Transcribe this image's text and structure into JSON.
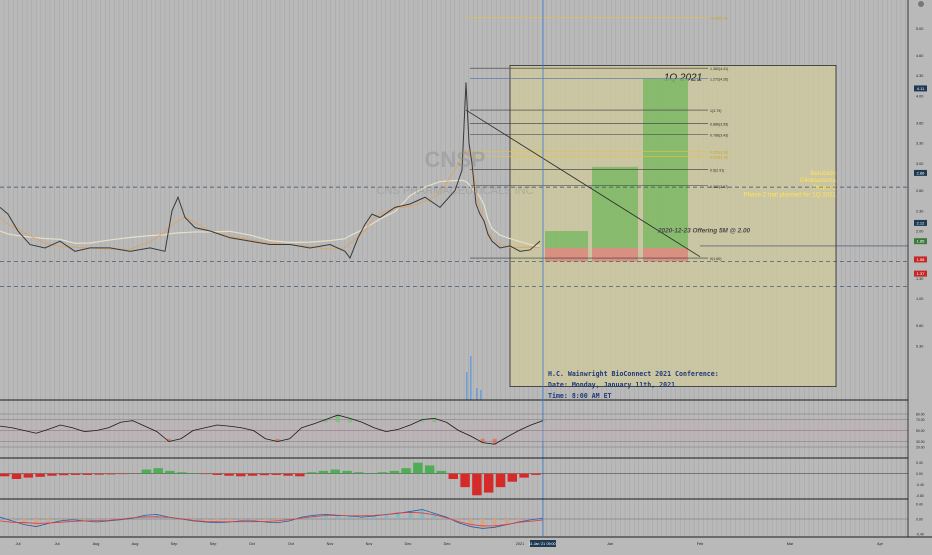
{
  "chart_data": {
    "type": "line",
    "title": "",
    "symbol": "CNSP",
    "company": "CNS PHARMACEUTICALS INC",
    "x_ticks": [
      "Jul",
      "Jul",
      "Aug",
      "Aug",
      "Sep",
      "Sep",
      "Oct",
      "Oct",
      "Nov",
      "Nov",
      "Dec",
      "Dec",
      "2021",
      "Jan",
      "Feb",
      "Mar",
      "Apr"
    ],
    "price_axis": [
      {
        "label": "5.00",
        "value": 5.0
      },
      {
        "label": "4.60",
        "value": 4.6
      },
      {
        "label": "4.30",
        "value": 4.3
      },
      {
        "label": "4.00",
        "value": 4.0
      },
      {
        "label": "3.60",
        "value": 3.6
      },
      {
        "label": "3.30",
        "value": 3.3
      },
      {
        "label": "3.00",
        "value": 3.0
      },
      {
        "label": "2.60",
        "value": 2.6
      },
      {
        "label": "2.30",
        "value": 2.3
      },
      {
        "label": "2.00",
        "value": 2.0
      },
      {
        "label": "1.60",
        "value": 1.6
      },
      {
        "label": "1.30",
        "value": 1.3
      },
      {
        "label": "1.00",
        "value": 1.0
      },
      {
        "label": "0.60",
        "value": 0.6
      },
      {
        "label": "0.30",
        "value": 0.3
      }
    ],
    "price_tags": [
      {
        "label": "4.11",
        "value": 4.11,
        "color": "#1f3a52"
      },
      {
        "label": "2.86",
        "value": 2.86,
        "color": "#1f3a52"
      },
      {
        "label": "2.12",
        "value": 2.12,
        "color": "#1f3a52"
      },
      {
        "label": "1.85",
        "value": 1.85,
        "color": "#3c7a3c"
      },
      {
        "label": "1.58",
        "value": 1.58,
        "color": "#c62828"
      },
      {
        "label": "1.37",
        "value": 1.37,
        "color": "#c62828"
      }
    ],
    "price_series": {
      "name": "CNSP",
      "x": [
        0,
        8,
        18,
        30,
        45,
        60,
        75,
        90,
        110,
        130,
        150,
        165,
        172,
        178,
        185,
        195,
        210,
        230,
        250,
        270,
        290,
        310,
        330,
        345,
        350,
        358,
        365,
        372,
        380,
        395,
        410,
        425,
        440,
        455,
        462,
        466,
        469,
        472,
        476,
        480,
        484,
        488,
        492,
        500,
        510,
        520,
        530,
        540
      ],
      "y": [
        2.35,
        2.25,
        2.0,
        1.8,
        1.75,
        1.85,
        1.7,
        1.75,
        1.75,
        1.7,
        1.75,
        1.7,
        2.3,
        2.5,
        2.2,
        2.05,
        2.0,
        1.9,
        1.85,
        1.8,
        1.8,
        1.75,
        1.8,
        1.7,
        1.6,
        1.9,
        2.1,
        2.25,
        2.2,
        2.35,
        2.4,
        2.5,
        2.35,
        2.6,
        2.9,
        4.2,
        3.3,
        3.0,
        2.4,
        2.25,
        2.15,
        1.95,
        1.85,
        1.75,
        1.78,
        1.7,
        1.72,
        1.85
      ]
    },
    "fib_levels": [
      {
        "label": "2.618(5.16)",
        "value": 5.16
      },
      {
        "label": "1.382(4.41)",
        "value": 4.41
      },
      {
        "label": "1.272(4.26)",
        "value": 4.26
      },
      {
        "label": "1(3.79)",
        "value": 3.79
      },
      {
        "label": "0.886(3.59)",
        "value": 3.59
      },
      {
        "label": "0.786(3.43)",
        "value": 3.43
      },
      {
        "label": "0.652(3.18)",
        "value": 3.18
      },
      {
        "label": "0.618(3.10)",
        "value": 3.1
      },
      {
        "label": "0.5(2.91)",
        "value": 2.91
      },
      {
        "label": "0.382(2.67)",
        "value": 2.67
      },
      {
        "label": "0(1.60)",
        "value": 1.6
      }
    ],
    "forecast_box": {
      "label": "1Q 2021",
      "x_start": 510,
      "x_end": 836,
      "top": 4.45,
      "bottom": -0.3,
      "targets": [
        {
          "value": 2.0,
          "x_start": 545,
          "x_end": 588
        },
        {
          "value": 2.95,
          "x_start": 592,
          "x_end": 638
        },
        {
          "value": 4.25,
          "x_start": 643,
          "x_end": 688
        }
      ],
      "stop": 1.55
    },
    "annotations": {
      "offering": "2020-12-23 Offering 5M @ 2.00",
      "drug_lines": [
        "Berubicin",
        "Glioblastoma",
        "Phase 2",
        "Phase 2 trial planned for  1Q 2021"
      ],
      "conference_lines": [
        "H.C. Wainwright BioConnect 2021 Conference:",
        "Date:   Monday, January 11th, 2021",
        "Time: 8:00 AM ET"
      ],
      "cursor_date": "11 Jan '21",
      "cursor_time": "09:00"
    },
    "panels": {
      "rsi": {
        "levels": [
          {
            "label": "80.00",
            "value": 80
          },
          {
            "label": "70.00",
            "value": 70
          },
          {
            "label": "50.00",
            "value": 50
          },
          {
            "label": "30.00",
            "value": 30
          },
          {
            "label": "20.00",
            "value": 20
          }
        ],
        "values": [
          58,
          55,
          50,
          45,
          52,
          60,
          55,
          48,
          50,
          55,
          65,
          68,
          58,
          48,
          30,
          35,
          50,
          55,
          60,
          58,
          55,
          50,
          35,
          30,
          35,
          55,
          62,
          70,
          78,
          72,
          65,
          55,
          48,
          52,
          60,
          70,
          72,
          65,
          50,
          40,
          28,
          25,
          38,
          50,
          60,
          68
        ]
      },
      "histogram": {
        "levels": [
          {
            "label": "0.40",
            "value": 0.4
          },
          {
            "label": "0.00",
            "value": 0
          },
          {
            "label": "-0.40",
            "value": -0.4
          },
          {
            "label": "-0.80",
            "value": -0.8
          }
        ],
        "values": [
          -0.1,
          -0.2,
          -0.15,
          -0.12,
          -0.08,
          -0.06,
          -0.05,
          -0.05,
          -0.04,
          -0.03,
          -0.02,
          -0.01,
          0.15,
          0.2,
          0.1,
          0.05,
          0.02,
          -0.02,
          -0.05,
          -0.08,
          -0.1,
          -0.08,
          -0.06,
          -0.05,
          -0.08,
          -0.1,
          0.05,
          0.1,
          0.15,
          0.1,
          0.05,
          0.02,
          0.05,
          0.1,
          0.2,
          0.4,
          0.3,
          0.1,
          -0.2,
          -0.5,
          -0.8,
          -0.7,
          -0.5,
          -0.3,
          -0.15,
          -0.05
        ]
      },
      "macd": {
        "levels": [
          {
            "label": "0.40",
            "value": 0.4
          },
          {
            "label": "0.00",
            "value": 0
          },
          {
            "label": "-0.40",
            "value": -0.4
          }
        ],
        "values": [
          0.05,
          -0.05,
          -0.15,
          -0.2,
          -0.12,
          -0.05,
          -0.02,
          -0.05,
          -0.08,
          -0.05,
          -0.02,
          0.02,
          0.1,
          0.12,
          0.05,
          0.0,
          -0.05,
          -0.08,
          -0.1,
          -0.08,
          -0.05,
          -0.05,
          -0.08,
          -0.1,
          -0.05,
          0.05,
          0.1,
          0.12,
          0.1,
          0.08,
          0.05,
          0.08,
          0.12,
          0.15,
          0.2,
          0.25,
          0.15,
          0.05,
          -0.1,
          -0.2,
          -0.25,
          -0.22,
          -0.15,
          -0.08,
          -0.02,
          0.02
        ]
      }
    }
  },
  "colors": {
    "background": "#b9b9b9",
    "box_fill": "#cdc79e",
    "target_fill": "#7db865",
    "stop_fill": "#d98a7d",
    "price_line": "#3a3a3a",
    "fib_gold": "#e8c33a",
    "annotation_yellow": "#ffe45c",
    "annotation_blue": "#1f3a7a",
    "cursor_blue": "#3a7bd5"
  }
}
